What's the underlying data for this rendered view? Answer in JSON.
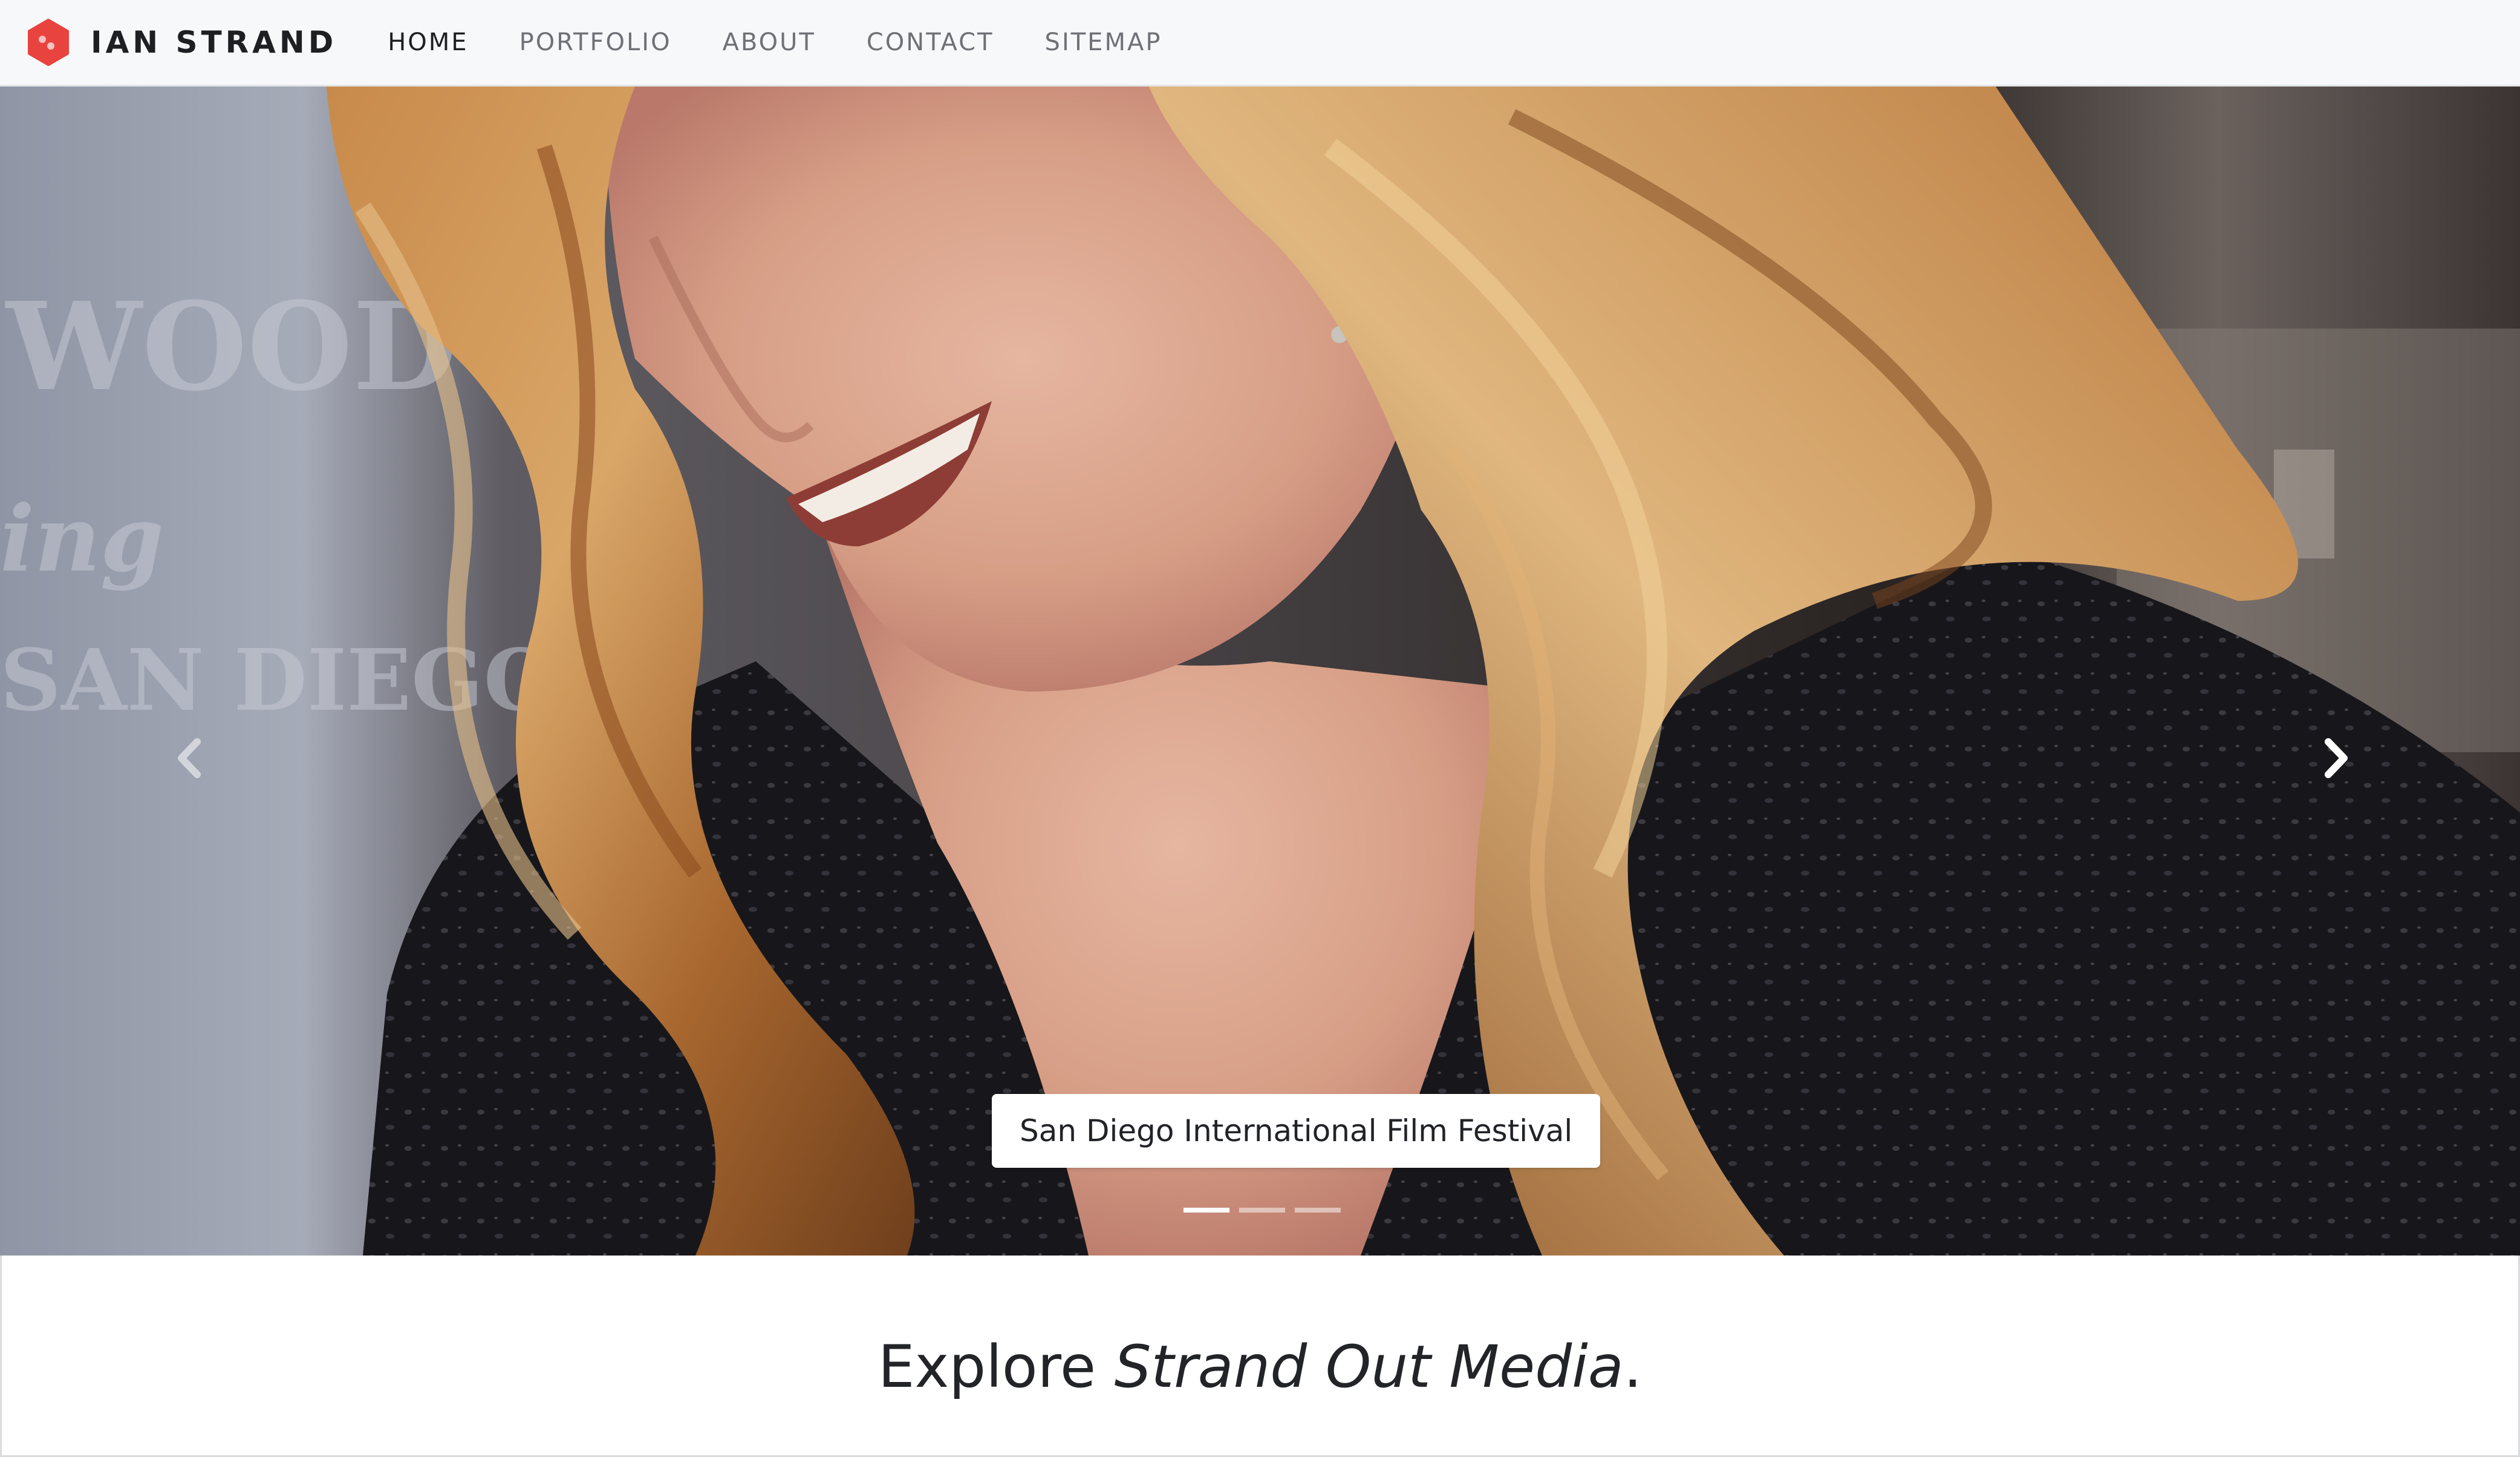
{
  "brand": {
    "name": "IAN STRAND",
    "logo_icon": "red-hexagon-logo-icon",
    "logo_color": "#e8433e"
  },
  "nav": {
    "items": [
      {
        "label": "HOME",
        "active": true
      },
      {
        "label": "PORTFOLIO",
        "active": false
      },
      {
        "label": "ABOUT",
        "active": false
      },
      {
        "label": "CONTACT",
        "active": false
      },
      {
        "label": "SITEMAP",
        "active": false
      }
    ]
  },
  "carousel": {
    "caption": "San Diego International Film Festival",
    "slide_count": 3,
    "active_slide": 1,
    "prev_icon": "chevron-left-icon",
    "next_icon": "chevron-right-icon"
  },
  "content": {
    "tagline_prefix": "Explore ",
    "tagline_emphasis": "Strand Out Media",
    "tagline_suffix": "."
  }
}
